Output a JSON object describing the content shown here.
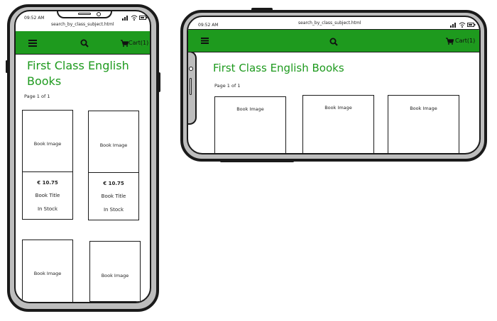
{
  "status": {
    "time": "09:52 AM",
    "url": "search_by_class_subject.html"
  },
  "navbar": {
    "menu_icon": "hamburger-menu-icon",
    "search_icon": "search-icon",
    "cart_icon": "shopping-cart-icon",
    "cart_label": "Cart(1)",
    "color": "#1e9a1e"
  },
  "page": {
    "title": "First Class English Books",
    "title_line1": "First Class English",
    "title_line2": "Books",
    "pagination": "Page 1 of 1"
  },
  "portrait": {
    "cards": [
      {
        "image_label": "Book Image",
        "price": "€ 10.75",
        "title": "Book Title",
        "stock": "In Stock"
      },
      {
        "image_label": "Book Image",
        "price": "€ 10.75",
        "title": "Book Title",
        "stock": "In Stock"
      },
      {
        "image_label": "Book Image"
      },
      {
        "image_label": "Book Image"
      }
    ]
  },
  "landscape": {
    "cards": [
      {
        "image_label": "Book Image"
      },
      {
        "image_label": "Book Image"
      },
      {
        "image_label": "Book Image"
      }
    ]
  }
}
